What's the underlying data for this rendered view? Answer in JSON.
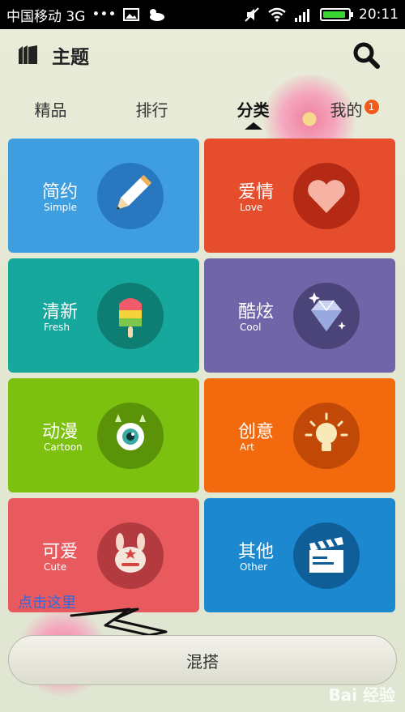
{
  "status_bar": {
    "carrier": "中国移动 3G",
    "dots": "•••",
    "time": "20:11",
    "icons": [
      "image-icon",
      "weather-icon",
      "mute-icon",
      "wifi-icon",
      "signal-icon",
      "battery-icon"
    ],
    "battery_level": 0.9
  },
  "header": {
    "title": "主题",
    "logo_icon": "theme-logo-icon",
    "search_icon": "search-icon"
  },
  "tabs": [
    {
      "label": "精品"
    },
    {
      "label": "排行"
    },
    {
      "label": "分类",
      "active": true
    },
    {
      "label": "我的",
      "badge": "1"
    }
  ],
  "categories": [
    {
      "cn": "简约",
      "en": "Simple",
      "color": "#3f9ee0",
      "circle": "#2878c0",
      "icon": "pencil-icon"
    },
    {
      "cn": "爱情",
      "en": "Love",
      "color": "#e64d2d",
      "circle": "#b52a15",
      "icon": "heart-icon"
    },
    {
      "cn": "清新",
      "en": "Fresh",
      "color": "#16a89c",
      "circle": "#0e7d72",
      "icon": "popsicle-icon"
    },
    {
      "cn": "酷炫",
      "en": "Cool",
      "color": "#6f65a8",
      "circle": "#4a4478",
      "icon": "diamond-icon"
    },
    {
      "cn": "动漫",
      "en": "Cartoon",
      "color": "#7cc10f",
      "circle": "#5a9208",
      "icon": "monster-eye-icon"
    },
    {
      "cn": "创意",
      "en": "Art",
      "color": "#f26a0d",
      "circle": "#c24808",
      "icon": "lightbulb-icon"
    },
    {
      "cn": "可爱",
      "en": "Cute",
      "color": "#e85a5e",
      "circle": "#b33a3e",
      "icon": "bunny-icon"
    },
    {
      "cn": "其他",
      "en": "Other",
      "color": "#1c88d0",
      "circle": "#0f5e98",
      "icon": "clapperboard-icon"
    }
  ],
  "annotation": "点击这里",
  "mix_button": "混搭",
  "watermark": "Bai 经验"
}
